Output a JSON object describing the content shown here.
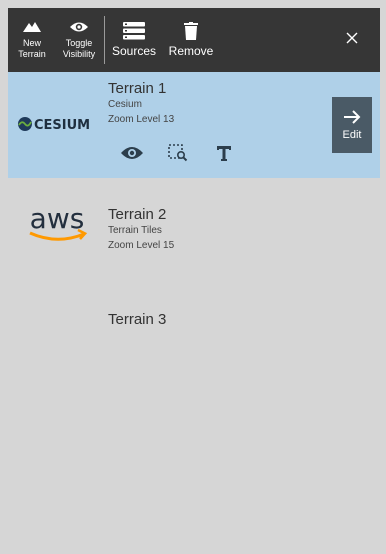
{
  "toolbar": {
    "new_terrain": {
      "line1": "New",
      "line2": "Terrain",
      "icon": "mountain-icon"
    },
    "toggle_visibility": {
      "line1": "Toggle",
      "line2": "Visibility",
      "icon": "eye-icon"
    },
    "sources": {
      "label": "Sources",
      "icon": "stack-icon"
    },
    "remove": {
      "label": "Remove",
      "icon": "trash-icon"
    },
    "close_icon": "close-icon"
  },
  "terrains": [
    {
      "title": "Terrain 1",
      "source": "Cesium",
      "zoom": "Zoom Level 13",
      "logo": "CESIUM",
      "selected": true
    },
    {
      "title": "Terrain 2",
      "source": "Terrain Tiles",
      "zoom": "Zoom Level 15",
      "logo": "aws",
      "selected": false
    },
    {
      "title": "Terrain 3",
      "source": "",
      "zoom": "",
      "logo": "",
      "selected": false
    }
  ],
  "actions": {
    "visibility_icon": "eye-icon",
    "select_area_icon": "zoom-selection-icon",
    "rename_icon": "text-t-icon"
  },
  "edit": {
    "label": "Edit",
    "icon": "arrow-right-icon"
  },
  "colors": {
    "toolbar_bg": "#363636",
    "background": "#d6d6d6",
    "selected_bg": "#afd0e8",
    "edit_bg": "#4a5a66",
    "aws_orange": "#ff9900",
    "cesium_green": "#6caf3f"
  }
}
